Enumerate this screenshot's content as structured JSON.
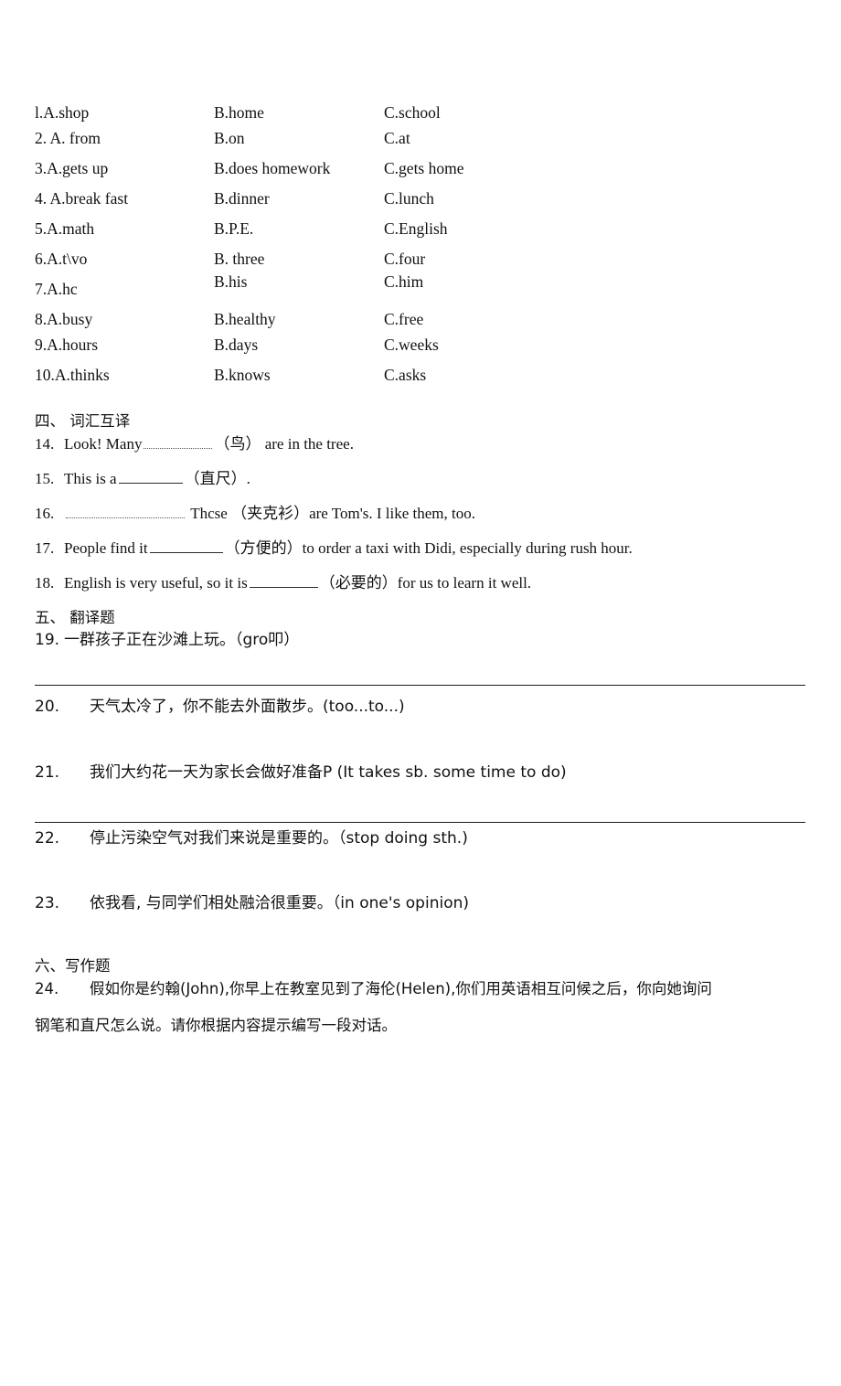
{
  "multiple_choice": {
    "rows": [
      {
        "a": "l.A.shop",
        "b": "B.home",
        "c": "C.school"
      },
      {
        "a": "2. A. from",
        "b": "B.on",
        "c": "C.at"
      },
      {
        "a": "3.A.gets up",
        "b": "B.does homework",
        "c": "C.gets home"
      },
      {
        "a": "4. A.break fast",
        "b": "B.dinner",
        "c": "C.lunch"
      },
      {
        "a": "5.A.math",
        "b": "B.P.E.",
        "c": "C.English"
      },
      {
        "a": "6.A.t\\vo",
        "b": "B. three",
        "c": "C.four"
      },
      {
        "a": "7.A.hc",
        "b": "B.his",
        "c": "C.him"
      },
      {
        "a": "8.A.busy",
        "b": "B.healthy",
        "c": "C.free"
      },
      {
        "a": "9.A.hours",
        "b": "B.days",
        "c": "C.weeks"
      },
      {
        "a": "10.A.thinks",
        "b": "B.knows",
        "c": "C.asks"
      }
    ]
  },
  "section_four": {
    "heading": "四、 词汇互译",
    "q14": {
      "num": "14.",
      "before": "Look! Many",
      "hint": "（鸟）",
      "after": "are in the tree."
    },
    "q15": {
      "num": "15.",
      "before": "This is a",
      "hint": "（直尺）",
      "after": "."
    },
    "q16": {
      "num": "16.",
      "before": "",
      "mid": "Thcse",
      "hint": "（夹克衫）",
      "after": "are Tom's. I like them, too."
    },
    "q17": {
      "num": "17.",
      "before": "People find it",
      "hint": "（方便的）",
      "after": "to order a taxi with Didi, especially during rush hour."
    },
    "q18": {
      "num": "18.",
      "before": "English is very useful, so it is",
      "hint": "（必要的）",
      "after": "for us to learn it well."
    }
  },
  "section_five": {
    "heading": "五、 翻译题",
    "q19": {
      "num": "19.",
      "text": "一群孩子正在沙滩上玩。（gro叩）"
    },
    "q20": {
      "num": "20.",
      "text": "天气太冷了，你不能去外面散步。(too...to...)"
    },
    "q21": {
      "num": "21.",
      "text": "我们大约花一天为家长会做好准备P (It takes sb. some time to do)"
    },
    "q22": {
      "num": "22.",
      "text": "停止污染空气对我们来说是重要的。（stop doing sth.)"
    },
    "q23": {
      "num": "23.",
      "text": "依我看, 与同学们相处融洽很重要。（in one's opinion)"
    }
  },
  "section_six": {
    "heading": "六、写作题",
    "q24": {
      "num": "24.",
      "line1": "假如你是约翰(John),你早上在教室见到了海伦(Helen),你们用英语相互问候之后，你向她询问",
      "line2": "钢笔和直尺怎么说。请你根据内容提示编写一段对话。"
    }
  }
}
